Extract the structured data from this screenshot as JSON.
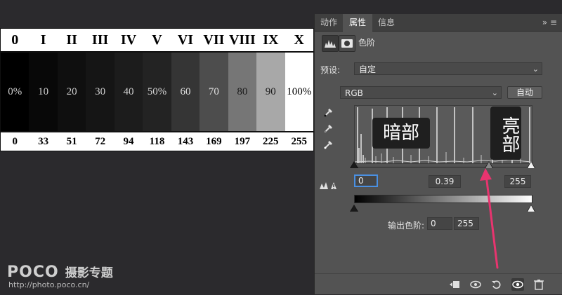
{
  "zone_chart": {
    "roman_labels": [
      "0",
      "I",
      "II",
      "III",
      "IV",
      "V",
      "VI",
      "VII",
      "VIII",
      "IX",
      "X"
    ],
    "bands": [
      {
        "label": "0%",
        "color": "#000000",
        "text": "#d0d0d0"
      },
      {
        "label": "10",
        "color": "#080808",
        "text": "#d0d0d0"
      },
      {
        "label": "20",
        "color": "#0f0f0f",
        "text": "#d0d0d0"
      },
      {
        "label": "30",
        "color": "#151515",
        "text": "#d0d0d0"
      },
      {
        "label": "40",
        "color": "#1c1c1c",
        "text": "#d0d0d0"
      },
      {
        "label": "50%",
        "color": "#232323",
        "text": "#d0d0d0"
      },
      {
        "label": "60",
        "color": "#353535",
        "text": "#e0e0e0"
      },
      {
        "label": "70",
        "color": "#4d4d4d",
        "text": "#e0e0e0"
      },
      {
        "label": "80",
        "color": "#767676",
        "text": "#1a1a1a"
      },
      {
        "label": "90",
        "color": "#a8a8a8",
        "text": "#1a1a1a"
      },
      {
        "label": "100%",
        "color": "#ffffff",
        "text": "#000000"
      }
    ],
    "values": [
      "0",
      "33",
      "51",
      "72",
      "94",
      "118",
      "143",
      "169",
      "197",
      "225",
      "255"
    ]
  },
  "panel": {
    "tabs": [
      {
        "label": "动作",
        "active": false
      },
      {
        "label": "属性",
        "active": true
      },
      {
        "label": "信息",
        "active": false
      }
    ],
    "menu_glyph": "»  ≡",
    "adjustment_name": "色阶",
    "preset_label": "预设:",
    "preset_value": "自定",
    "channel_value": "RGB",
    "auto_button": "自动",
    "callouts": {
      "shadows": "暗部",
      "highlights": "亮部"
    },
    "input_levels": {
      "black": "0",
      "gamma": "0.39",
      "white": "255"
    },
    "output_label": "输出色阶:",
    "output_levels": {
      "black": "0",
      "white": "255"
    }
  },
  "colors": {
    "arrow": "#e8346f",
    "focus": "#4a90e2"
  },
  "watermark": {
    "logo_text": "POCO",
    "logo_cn": "摄影专题",
    "url": "http://photo.poco.cn/"
  }
}
